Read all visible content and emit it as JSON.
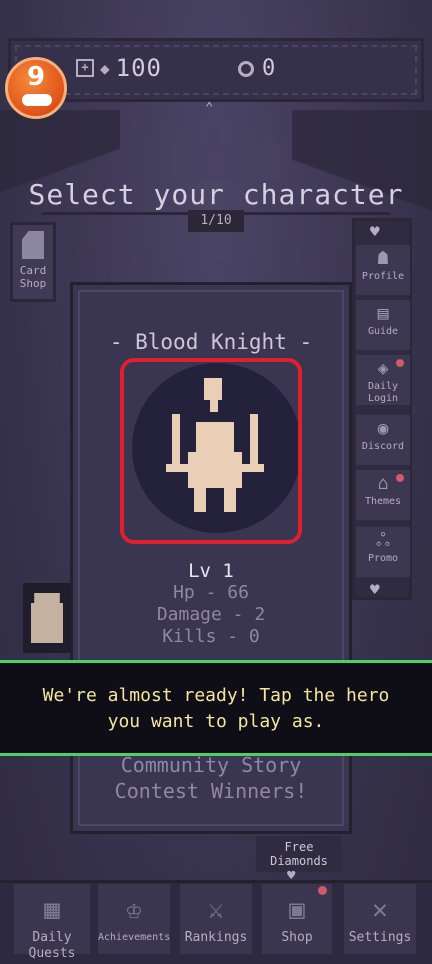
{
  "app_badge": {
    "label": "9"
  },
  "topbar": {
    "plus_symbol": "+",
    "gem_icon": "diamond-icon",
    "gems": "100",
    "coin_icon": "coin-icon",
    "coins": "0"
  },
  "screen": {
    "title": "Select your character",
    "counter": "1/10"
  },
  "card_shop": {
    "label": "Card Shop"
  },
  "side_menu": [
    {
      "label": "Profile",
      "icon": "profile-icon",
      "notify": false
    },
    {
      "label": "Guide",
      "icon": "guide-icon",
      "notify": false
    },
    {
      "label": "Daily Login",
      "icon": "daily-login-icon",
      "notify": true
    },
    {
      "label": "Discord",
      "icon": "discord-icon",
      "notify": false
    },
    {
      "label": "Themes",
      "icon": "themes-icon",
      "notify": true
    },
    {
      "label": "Promo",
      "icon": "promo-icon",
      "notify": false
    }
  ],
  "character": {
    "name": "- Blood Knight -",
    "level": "Lv 1",
    "hp": "Hp - 66",
    "damage": "Damage - 2",
    "kills": "Kills - 0"
  },
  "tutorial": {
    "line1": "We're almost ready! Tap the hero",
    "line2": "you want to play as."
  },
  "contest": {
    "line1": "Community Story",
    "line2": "Contest Winners!"
  },
  "free_diamonds": {
    "line1": "Free",
    "line2": "Diamonds"
  },
  "bottom_nav": {
    "daily_quests": "Daily Quests",
    "achievements": "Achievements",
    "rankings": "Rankings",
    "shop": "Shop",
    "settings": "Settings"
  },
  "colors": {
    "highlight_border": "#e0202c",
    "banner_border": "#4cd06a",
    "banner_text": "#f2e6a0",
    "notify_dot": "#d25a6a"
  }
}
